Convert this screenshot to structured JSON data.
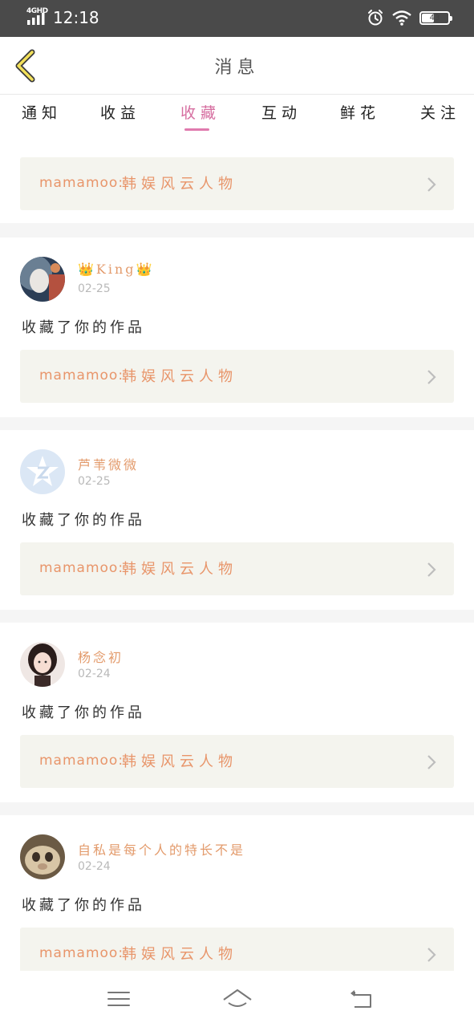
{
  "status_bar": {
    "network": "4GHD",
    "time": "12:18",
    "battery": "43",
    "icons": [
      "signal-icon",
      "alarm-icon",
      "wifi-icon",
      "battery-icon"
    ]
  },
  "header": {
    "title": "消息",
    "back_icon": "chevron-left-icon"
  },
  "tabs": [
    {
      "label": "通知",
      "active": false
    },
    {
      "label": "收益",
      "active": false
    },
    {
      "label": "收藏",
      "active": true
    },
    {
      "label": "互动",
      "active": false
    },
    {
      "label": "鲜花",
      "active": false
    },
    {
      "label": "关注",
      "active": false
    }
  ],
  "feed": {
    "partial_card": {
      "work_author": "mamamoo:",
      "work_title": "韩娱风云人物"
    },
    "items": [
      {
        "username": "👑King👑",
        "date": "02-25",
        "action": "收藏了你的作品",
        "work_author": "mamamoo:",
        "work_title": "韩娱风云人物"
      },
      {
        "username": "芦苇微微",
        "date": "02-25",
        "action": "收藏了你的作品",
        "work_author": "mamamoo:",
        "work_title": "韩娱风云人物"
      },
      {
        "username": "杨念初",
        "date": "02-24",
        "action": "收藏了你的作品",
        "work_author": "mamamoo:",
        "work_title": "韩娱风云人物"
      },
      {
        "username": "自私是每个人的特长不是",
        "date": "02-24",
        "action": "收藏了你的作品",
        "work_author": "mamamoo:",
        "work_title": "韩娱风云人物"
      }
    ]
  },
  "bottom_nav": {
    "icons": [
      "menu-icon",
      "home-icon",
      "back-icon"
    ]
  },
  "colors": {
    "accent": "#e07aae",
    "orange": "#e8956a",
    "work_bg": "#f4f4ee"
  }
}
